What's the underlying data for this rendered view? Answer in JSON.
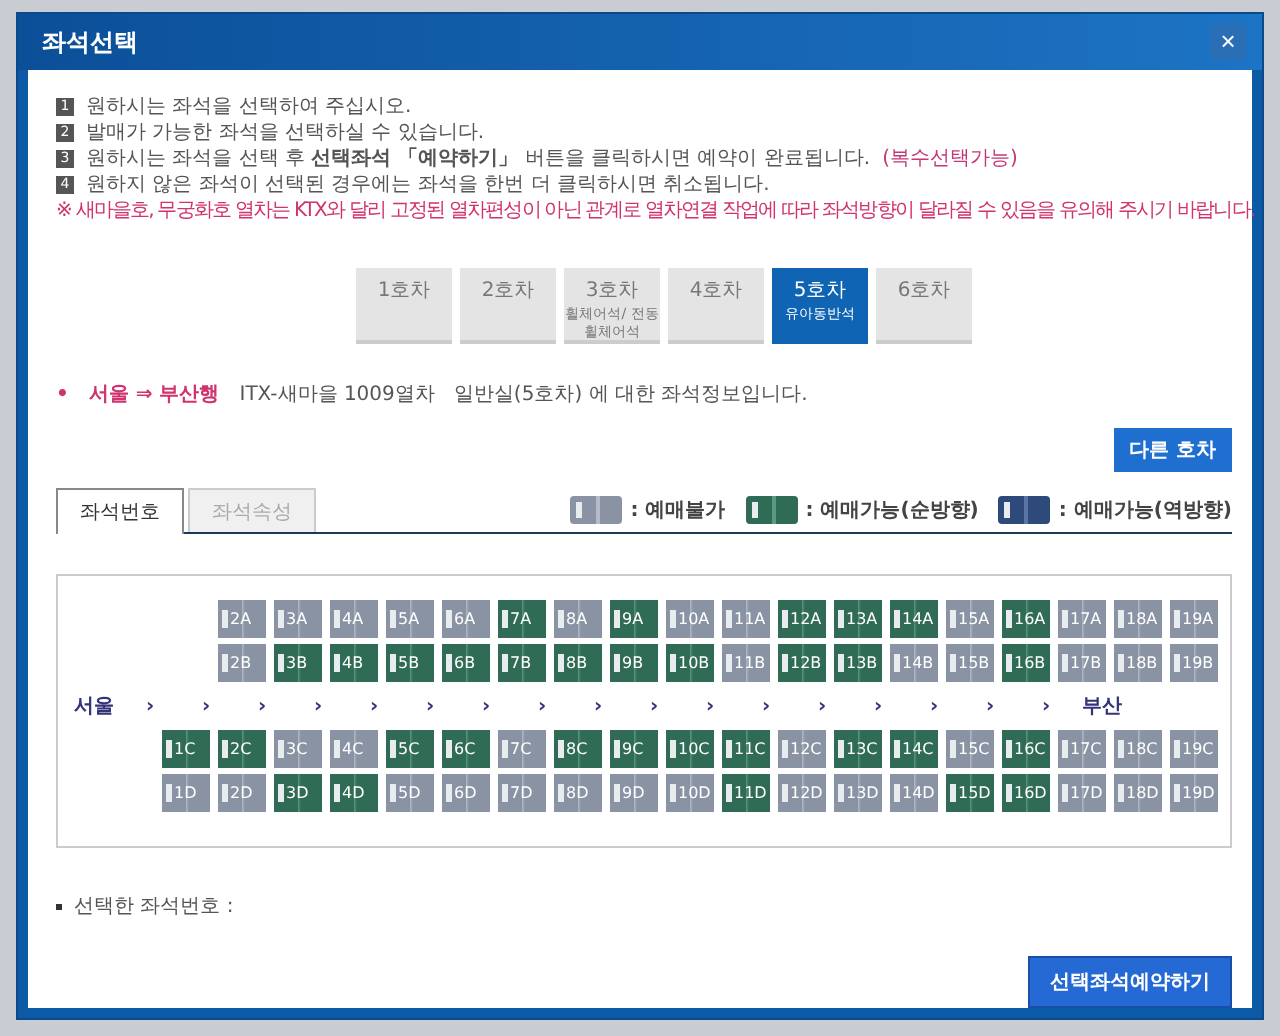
{
  "window": {
    "title": "좌석선택",
    "close": "×"
  },
  "instructions": [
    {
      "number": "1",
      "text": "원하시는 좌석을 선택하여 주십시오."
    },
    {
      "number": "2",
      "text": "발매가 가능한 좌석을 선택하실 수 있습니다."
    },
    {
      "number": "3",
      "text": "원하시는 좌석을 선택 후 **선택좌석 「예약하기」** 버튼을 클릭하시면 예약이 완료됩니다.",
      "note": "(복수선택가능)"
    },
    {
      "number": "4",
      "text": "원하지 않은 좌석이 선택된 경우에는 좌석을 한번 더 클릭하시면 취소됩니다."
    }
  ],
  "warning": "※ 새마을호, 무궁화호 열차는 KTX와 달리 고정된 열차편성이 아닌 관계로 열차연결 작업에 따라 좌석방향이 달라질 수 있음을 유의해 주시기 바랍니다.",
  "cars": [
    {
      "label": "1호차",
      "selected": false
    },
    {
      "label": "2호차",
      "selected": false
    },
    {
      "label": "3호차",
      "sub": "휠체어석/ 전동휠체어석",
      "selected": false
    },
    {
      "label": "4호차",
      "selected": false
    },
    {
      "label": "5호차",
      "sub": "유아동반석",
      "selected": true
    },
    {
      "label": "6호차",
      "selected": false
    }
  ],
  "route": {
    "bullet": "•",
    "title": "서울 ⇒ 부산행",
    "info": "ITX-새마을 1009열차   일반실(5호차) 에 대한 좌석정보입니다."
  },
  "other_car_button": "다른 호차",
  "tabs": [
    {
      "label": "좌석번호",
      "selected": true
    },
    {
      "label": "좌석속성",
      "selected": false
    }
  ],
  "legend": [
    {
      "kind": "unavailable",
      "label": ": 예매불가"
    },
    {
      "kind": "forward",
      "label": ": 예매가능(순방향)"
    },
    {
      "kind": "reverse",
      "label": ": 예매가능(역방향)"
    }
  ],
  "seat_rows": [
    {
      "seats": [
        {
          "label": "2A",
          "kind": "unavailable"
        },
        {
          "label": "3A",
          "kind": "unavailable"
        },
        {
          "label": "4A",
          "kind": "unavailable"
        },
        {
          "label": "5A",
          "kind": "unavailable"
        },
        {
          "label": "6A",
          "kind": "unavailable"
        },
        {
          "label": "7A",
          "kind": "forward"
        },
        {
          "label": "8A",
          "kind": "unavailable"
        },
        {
          "label": "9A",
          "kind": "forward"
        },
        {
          "label": "10A",
          "kind": "unavailable"
        },
        {
          "label": "11A",
          "kind": "unavailable"
        },
        {
          "label": "12A",
          "kind": "forward"
        },
        {
          "label": "13A",
          "kind": "forward"
        },
        {
          "label": "14A",
          "kind": "forward"
        },
        {
          "label": "15A",
          "kind": "unavailable"
        },
        {
          "label": "16A",
          "kind": "forward"
        },
        {
          "label": "17A",
          "kind": "unavailable"
        },
        {
          "label": "18A",
          "kind": "unavailable"
        },
        {
          "label": "19A",
          "kind": "unavailable"
        }
      ]
    },
    {
      "seats": [
        {
          "label": "2B",
          "kind": "unavailable"
        },
        {
          "label": "3B",
          "kind": "forward"
        },
        {
          "label": "4B",
          "kind": "forward"
        },
        {
          "label": "5B",
          "kind": "forward"
        },
        {
          "label": "6B",
          "kind": "forward"
        },
        {
          "label": "7B",
          "kind": "forward"
        },
        {
          "label": "8B",
          "kind": "forward"
        },
        {
          "label": "9B",
          "kind": "forward"
        },
        {
          "label": "10B",
          "kind": "forward"
        },
        {
          "label": "11B",
          "kind": "unavailable"
        },
        {
          "label": "12B",
          "kind": "forward"
        },
        {
          "label": "13B",
          "kind": "forward"
        },
        {
          "label": "14B",
          "kind": "unavailable"
        },
        {
          "label": "15B",
          "kind": "unavailable"
        },
        {
          "label": "16B",
          "kind": "forward"
        },
        {
          "label": "17B",
          "kind": "unavailable"
        },
        {
          "label": "18B",
          "kind": "unavailable"
        },
        {
          "label": "19B",
          "kind": "unavailable"
        }
      ]
    },
    {
      "aisle": {
        "from": "서울",
        "arrows": [
          "›",
          "›",
          "›",
          "›",
          "›",
          "›",
          "›",
          "›",
          "›",
          "›",
          "›",
          "›",
          "›",
          "›",
          "›",
          "›",
          "›"
        ],
        "to": "부산"
      }
    },
    {
      "seats": [
        {
          "label": "1C",
          "kind": "forward"
        },
        {
          "label": "2C",
          "kind": "forward"
        },
        {
          "label": "3C",
          "kind": "unavailable"
        },
        {
          "label": "4C",
          "kind": "unavailable"
        },
        {
          "label": "5C",
          "kind": "forward"
        },
        {
          "label": "6C",
          "kind": "forward"
        },
        {
          "label": "7C",
          "kind": "unavailable"
        },
        {
          "label": "8C",
          "kind": "forward"
        },
        {
          "label": "9C",
          "kind": "forward"
        },
        {
          "label": "10C",
          "kind": "forward"
        },
        {
          "label": "11C",
          "kind": "forward"
        },
        {
          "label": "12C",
          "kind": "unavailable"
        },
        {
          "label": "13C",
          "kind": "forward"
        },
        {
          "label": "14C",
          "kind": "forward"
        },
        {
          "label": "15C",
          "kind": "unavailable"
        },
        {
          "label": "16C",
          "kind": "forward"
        },
        {
          "label": "17C",
          "kind": "unavailable"
        },
        {
          "label": "18C",
          "kind": "unavailable"
        },
        {
          "label": "19C",
          "kind": "unavailable"
        }
      ]
    },
    {
      "seats": [
        {
          "label": "1D",
          "kind": "unavailable"
        },
        {
          "label": "2D",
          "kind": "unavailable"
        },
        {
          "label": "3D",
          "kind": "forward"
        },
        {
          "label": "4D",
          "kind": "forward"
        },
        {
          "label": "5D",
          "kind": "unavailable"
        },
        {
          "label": "6D",
          "kind": "unavailable"
        },
        {
          "label": "7D",
          "kind": "unavailable"
        },
        {
          "label": "8D",
          "kind": "unavailable"
        },
        {
          "label": "9D",
          "kind": "unavailable"
        },
        {
          "label": "10D",
          "kind": "unavailable"
        },
        {
          "label": "11D",
          "kind": "forward"
        },
        {
          "label": "12D",
          "kind": "unavailable"
        },
        {
          "label": "13D",
          "kind": "unavailable"
        },
        {
          "label": "14D",
          "kind": "unavailable"
        },
        {
          "label": "15D",
          "kind": "forward"
        },
        {
          "label": "16D",
          "kind": "forward"
        },
        {
          "label": "17D",
          "kind": "unavailable"
        },
        {
          "label": "18D",
          "kind": "unavailable"
        },
        {
          "label": "19D",
          "kind": "unavailable"
        }
      ]
    }
  ],
  "selected_label": "선택한 좌석번호 :",
  "reserve_button": "선택좌석예약하기"
}
